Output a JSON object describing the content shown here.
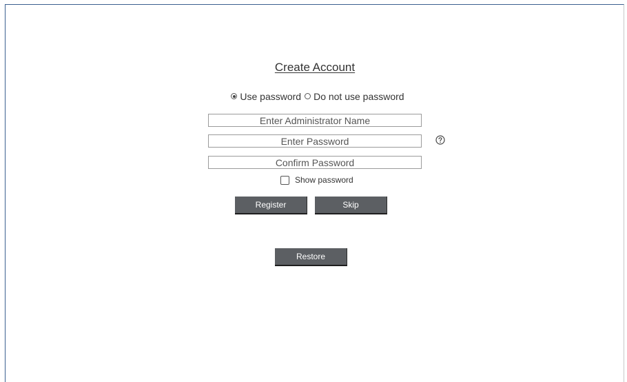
{
  "form": {
    "title": "Create Account",
    "radio_use_password": "Use password",
    "radio_no_password": "Do not use password",
    "admin_name_placeholder": "Enter Administrator Name",
    "password_placeholder": "Enter Password",
    "confirm_placeholder": "Confirm Password",
    "show_password_label": "Show password",
    "selected_option": "Use password",
    "show_password_checked": false
  },
  "buttons": {
    "register": "Register",
    "skip": "Skip",
    "restore": "Restore"
  },
  "icons": {
    "help": "help-circle-icon"
  },
  "colors": {
    "button_bg": "#5c5f63",
    "button_text": "#ffffff",
    "frame_border": "#3a5f8f"
  }
}
